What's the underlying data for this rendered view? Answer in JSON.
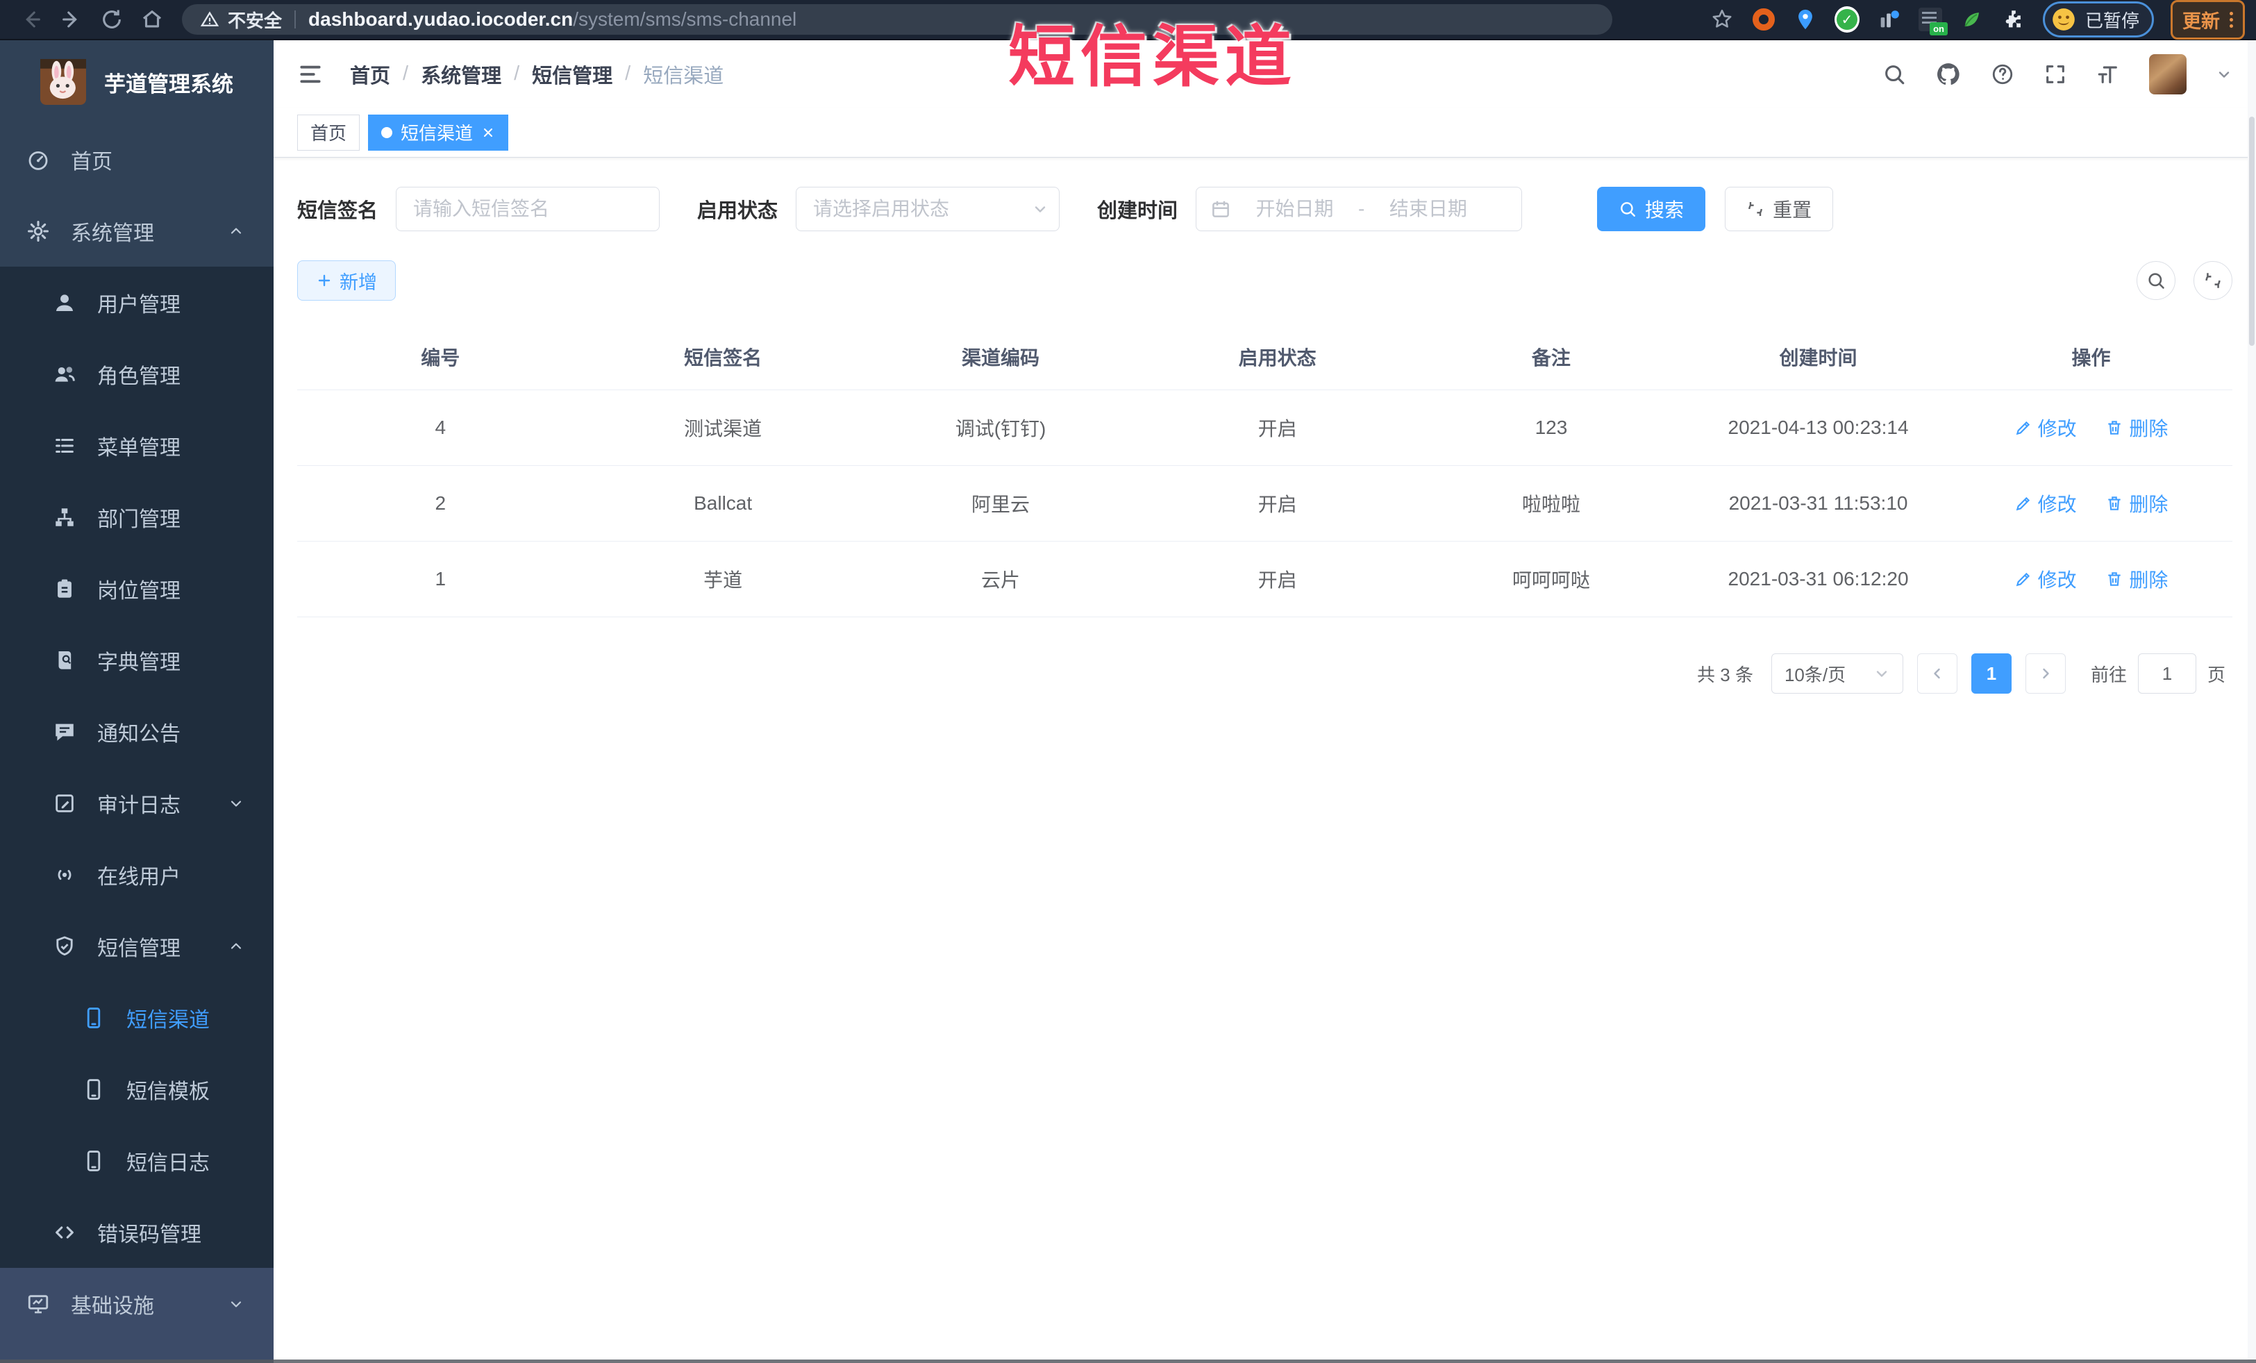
{
  "browser": {
    "security_label": "不安全",
    "url_host": "dashboard.yudao.iocoder.cn",
    "url_path": "/system/sms/sms-channel",
    "paused_label": "已暂停",
    "update_label": "更新"
  },
  "annotation": {
    "title": "短信渠道"
  },
  "sidebar": {
    "app_title": "芋道管理系统",
    "items": [
      {
        "label": "首页"
      },
      {
        "label": "系统管理"
      },
      {
        "label": "用户管理"
      },
      {
        "label": "角色管理"
      },
      {
        "label": "菜单管理"
      },
      {
        "label": "部门管理"
      },
      {
        "label": "岗位管理"
      },
      {
        "label": "字典管理"
      },
      {
        "label": "通知公告"
      },
      {
        "label": "审计日志"
      },
      {
        "label": "在线用户"
      },
      {
        "label": "短信管理"
      },
      {
        "label": "短信渠道"
      },
      {
        "label": "短信模板"
      },
      {
        "label": "短信日志"
      },
      {
        "label": "错误码管理"
      },
      {
        "label": "基础设施"
      }
    ]
  },
  "header": {
    "breadcrumb": [
      "首页",
      "系统管理",
      "短信管理",
      "短信渠道"
    ],
    "separator": "/"
  },
  "tags": {
    "home": "首页",
    "active": "短信渠道"
  },
  "filters": {
    "sign_label": "短信签名",
    "sign_placeholder": "请输入短信签名",
    "status_label": "启用状态",
    "status_placeholder": "请选择启用状态",
    "time_label": "创建时间",
    "start_placeholder": "开始日期",
    "range_separator": "-",
    "end_placeholder": "结束日期",
    "search_label": "搜索",
    "reset_label": "重置"
  },
  "toolbar": {
    "add_label": "新增"
  },
  "table": {
    "columns": [
      "编号",
      "短信签名",
      "渠道编码",
      "启用状态",
      "备注",
      "创建时间",
      "操作"
    ],
    "rows": [
      {
        "id": "4",
        "sign": "测试渠道",
        "code": "调试(钉钉)",
        "status": "开启",
        "remark": "123",
        "created": "2021-04-13 00:23:14"
      },
      {
        "id": "2",
        "sign": "Ballcat",
        "code": "阿里云",
        "status": "开启",
        "remark": "啦啦啦",
        "created": "2021-03-31 11:53:10"
      },
      {
        "id": "1",
        "sign": "芋道",
        "code": "云片",
        "status": "开启",
        "remark": "呵呵呵哒",
        "created": "2021-03-31 06:12:20"
      }
    ],
    "edit_label": "修改",
    "delete_label": "删除"
  },
  "pagination": {
    "total_label": "共 3 条",
    "page_size_label": "10条/页",
    "current_page": "1",
    "goto_prefix": "前往",
    "goto_value": "1",
    "goto_suffix": "页"
  },
  "colors": {
    "accent": "#409eff",
    "sidebar_bg": "#304156",
    "submenu_bg": "#1f2d3d",
    "annotation_red": "#f43b5e"
  }
}
